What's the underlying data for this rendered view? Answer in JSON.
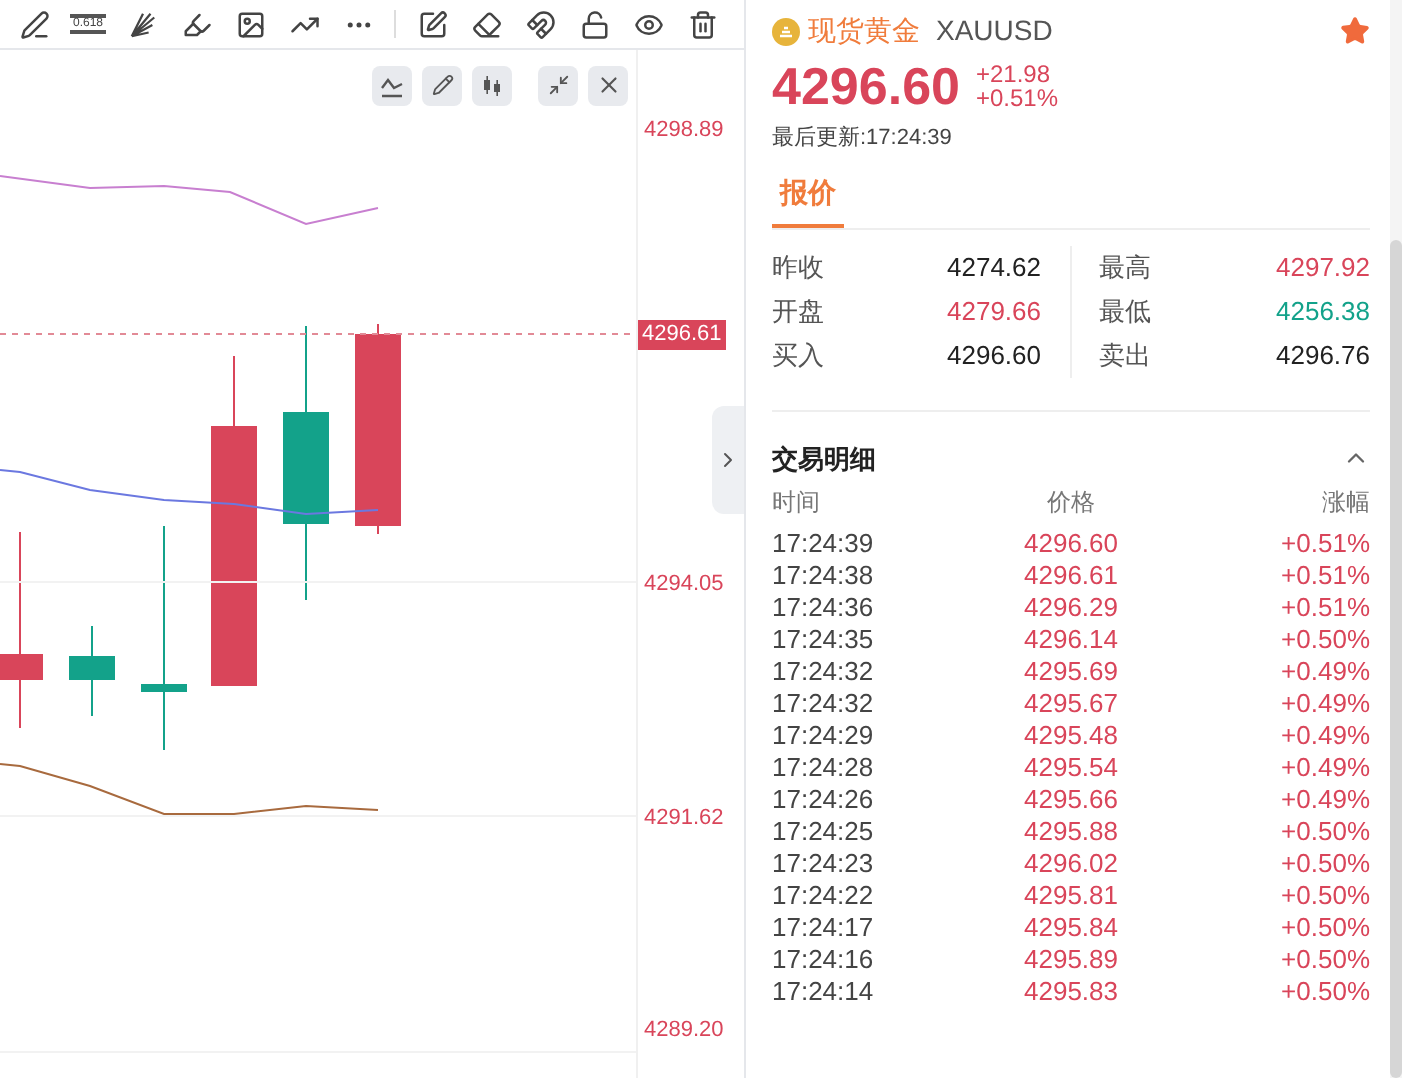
{
  "toolbar": {
    "fib_label": "0.618"
  },
  "chart": {
    "yticks": [
      "4298.89",
      "4294.05",
      "4291.62",
      "4289.20"
    ],
    "current_price": "4296.61"
  },
  "quote": {
    "name": "现货黄金",
    "symbol": "XAUUSD",
    "favorite": true,
    "price": "4296.60",
    "change": "+21.98",
    "change_pct": "+0.51%",
    "updated": "最后更新:17:24:39"
  },
  "tabs": [
    {
      "label": "报价",
      "selected": true
    }
  ],
  "stats": [
    {
      "label": "昨收",
      "value": "4274.62",
      "color": "#222222"
    },
    {
      "label": "最高",
      "value": "4297.92",
      "color": "#d9455a"
    },
    {
      "label": "开盘",
      "value": "4279.66",
      "color": "#d9455a"
    },
    {
      "label": "最低",
      "value": "4256.38",
      "color": "#13a28a"
    },
    {
      "label": "买入",
      "value": "4296.60",
      "color": "#222222"
    },
    {
      "label": "卖出",
      "value": "4296.76",
      "color": "#222222"
    }
  ],
  "trades": {
    "title": "交易明细",
    "expanded": true,
    "columns": [
      "时间",
      "价格",
      "涨幅"
    ],
    "rows": [
      {
        "time": "17:24:39",
        "price": "4296.60",
        "change": "+0.51%"
      },
      {
        "time": "17:24:38",
        "price": "4296.61",
        "change": "+0.51%"
      },
      {
        "time": "17:24:36",
        "price": "4296.29",
        "change": "+0.51%"
      },
      {
        "time": "17:24:35",
        "price": "4296.14",
        "change": "+0.50%"
      },
      {
        "time": "17:24:32",
        "price": "4295.69",
        "change": "+0.49%"
      },
      {
        "time": "17:24:32",
        "price": "4295.67",
        "change": "+0.49%"
      },
      {
        "time": "17:24:29",
        "price": "4295.48",
        "change": "+0.49%"
      },
      {
        "time": "17:24:28",
        "price": "4295.54",
        "change": "+0.49%"
      },
      {
        "time": "17:24:26",
        "price": "4295.66",
        "change": "+0.49%"
      },
      {
        "time": "17:24:25",
        "price": "4295.88",
        "change": "+0.50%"
      },
      {
        "time": "17:24:23",
        "price": "4296.02",
        "change": "+0.50%"
      },
      {
        "time": "17:24:22",
        "price": "4295.81",
        "change": "+0.50%"
      },
      {
        "time": "17:24:17",
        "price": "4295.84",
        "change": "+0.50%"
      },
      {
        "time": "17:24:16",
        "price": "4295.89",
        "change": "+0.50%"
      },
      {
        "time": "17:24:14",
        "price": "4295.83",
        "change": "+0.50%"
      }
    ]
  }
}
